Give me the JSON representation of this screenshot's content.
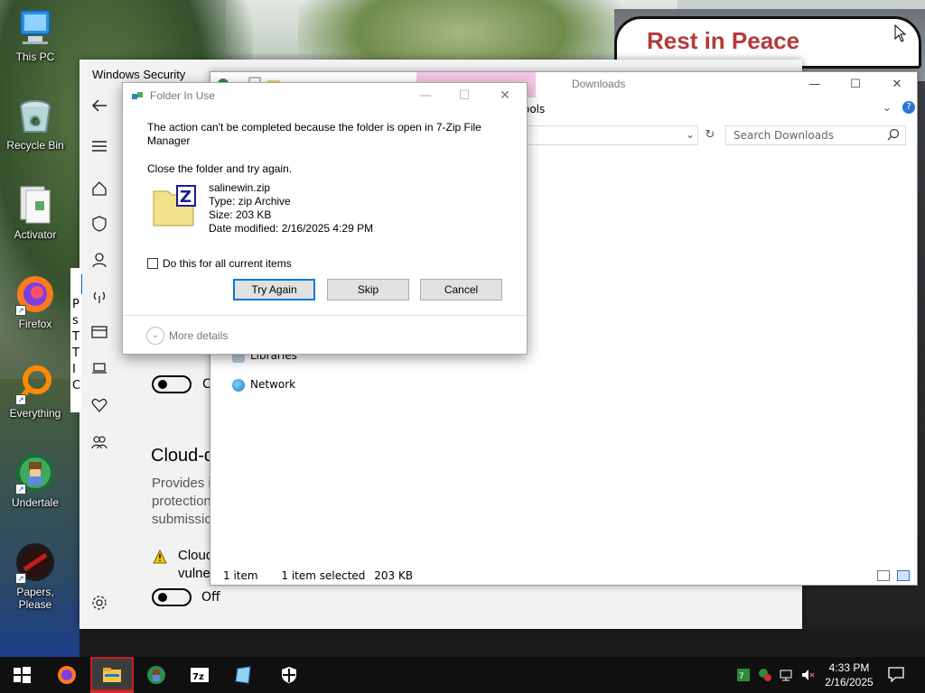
{
  "desktop": {
    "wallpaper_text": "Rest in Peace",
    "icons": [
      {
        "label": "This PC",
        "icon": "computer-icon"
      },
      {
        "label": "Recycle Bin",
        "icon": "recycle-bin-icon"
      },
      {
        "label": "Activator",
        "icon": "file-icon"
      },
      {
        "label": "Firefox",
        "icon": "firefox-icon"
      },
      {
        "label": "Everything",
        "icon": "everything-search-icon"
      },
      {
        "label": "Undertale",
        "icon": "undertale-icon"
      },
      {
        "label": "Papers, Please",
        "icon": "papers-please-icon"
      }
    ]
  },
  "windows_security": {
    "title": "Windows Security",
    "side_letters": [
      "s",
      "T",
      "T",
      "I",
      "C"
    ],
    "side_letter_top": "P",
    "toggle_partial_label": "C",
    "section_heading_partial": "Cloud-d",
    "description_partial": [
      "Provides i",
      "protection",
      "submissio"
    ],
    "warning_partial": [
      "Cloud",
      "vulne"
    ],
    "toggle_off_label": "Off",
    "nav_icons": [
      "back-arrow-icon",
      "hamburger-menu-icon",
      "home-icon",
      "shield-icon",
      "person-icon",
      "wireless-icon",
      "app-browser-icon",
      "laptop-icon",
      "health-heart-icon",
      "family-icon",
      "settings-gear-icon"
    ]
  },
  "explorer": {
    "title": "Downloads",
    "ribbon_partial": "ools",
    "search_placeholder": "Search Downloads",
    "nav_items": [
      {
        "label": "Libraries",
        "icon": "libraries-icon"
      },
      {
        "label": "Network",
        "icon": "network-icon"
      }
    ],
    "status": {
      "item_count": "1 item",
      "selected": "1 item selected",
      "size": "203 KB"
    }
  },
  "dialog": {
    "title": "Folder In Use",
    "message": "The action can't be completed because the folder is open in 7-Zip File Manager",
    "instruction": "Close the folder and try again.",
    "file": {
      "name": "salinewin.zip",
      "type": "Type: zip Archive",
      "size": "Size: 203 KB",
      "modified": "Date modified: 2/16/2025 4:29 PM"
    },
    "checkbox_label": "Do this for all current items",
    "checkbox_checked": false,
    "buttons": {
      "try_again": "Try Again",
      "skip": "Skip",
      "cancel": "Cancel"
    },
    "more_details": "More details"
  },
  "taskbar": {
    "items": [
      "start-icon",
      "firefox-icon",
      "file-explorer-icon",
      "undertale-icon",
      "7zip-icon",
      "notepad-icon",
      "windows-security-icon"
    ],
    "active_item": "file-explorer-icon",
    "time": "4:33 PM",
    "date": "2/16/2025",
    "tray_icons": [
      "7zip-tray-icon",
      "security-warning-icon",
      "network-icon",
      "volume-muted-icon"
    ]
  },
  "colors": {
    "accent": "#0078d7",
    "taskbar": "#101010",
    "active_taskbar_border": "#c42424",
    "pink_tab": "#f6c6e6"
  }
}
